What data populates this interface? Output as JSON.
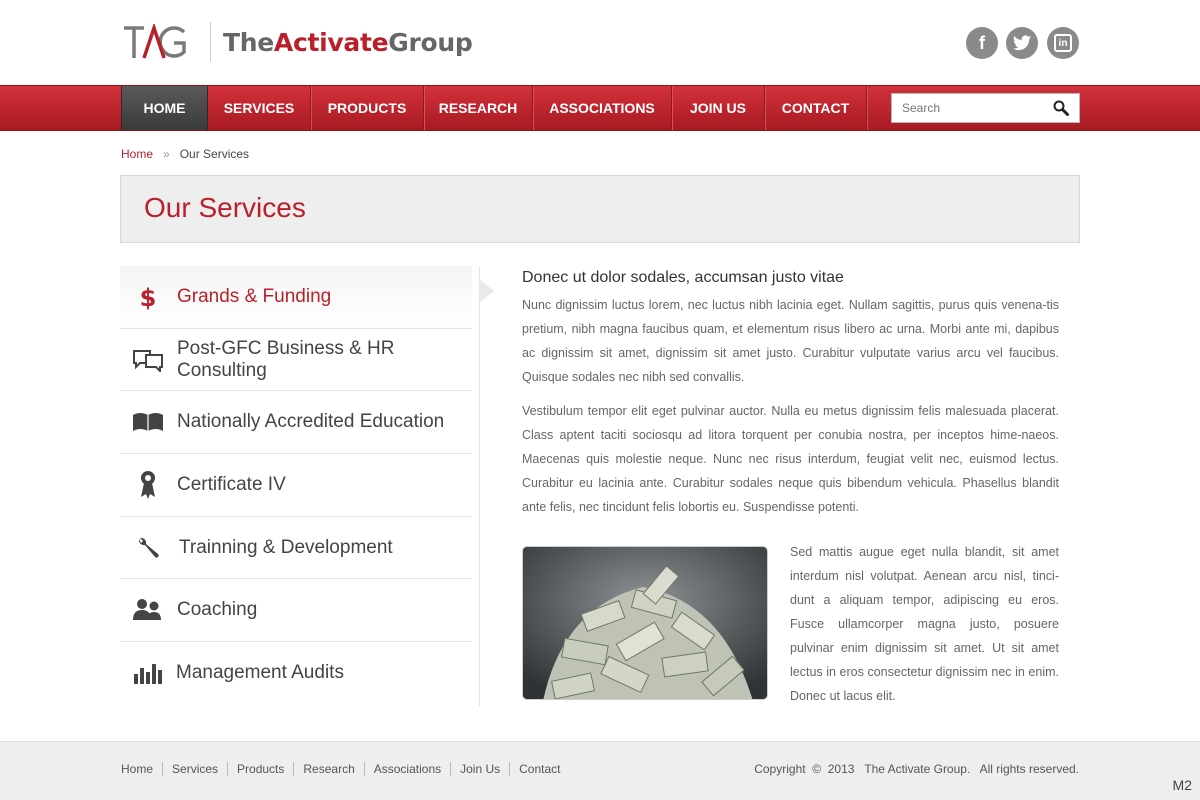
{
  "header": {
    "logo_mark": "TAG",
    "logo_part1": "The",
    "logo_part2": "Activate",
    "logo_part3": "Group",
    "social": [
      {
        "name": "facebook",
        "glyph": "f"
      },
      {
        "name": "twitter",
        "glyph": "t"
      },
      {
        "name": "linkedin",
        "glyph": "in"
      }
    ]
  },
  "nav": {
    "items": [
      "HOME",
      "SERVICES",
      "PRODUCTS",
      "RESEARCH",
      "ASSOCIATIONS",
      "JOIN US",
      "CONTACT"
    ],
    "active": "HOME",
    "search_placeholder": "Search"
  },
  "breadcrumb": {
    "home": "Home",
    "sep": "»",
    "current": "Our Services"
  },
  "page_title": "Our Services",
  "sidebar": {
    "items": [
      {
        "label": "Grands & Funding",
        "icon": "dollar-icon"
      },
      {
        "label": "Post-GFC Business & HR Consulting",
        "icon": "chat-bubbles-icon"
      },
      {
        "label": "Nationally Accredited Education",
        "icon": "open-book-icon"
      },
      {
        "label": "Certificate IV",
        "icon": "award-ribbon-icon"
      },
      {
        "label": "Trainning & Development",
        "icon": "wrench-icon"
      },
      {
        "label": "Coaching",
        "icon": "people-icon"
      },
      {
        "label": "Management Audits",
        "icon": "bar-chart-icon"
      }
    ]
  },
  "content": {
    "heading": "Donec ut dolor sodales, accumsan justo vitae",
    "paragraph1": "Nunc dignissim luctus lorem, nec luctus nibh lacinia eget. Nullam sagittis, purus quis venena-tis pretium, nibh magna faucibus quam, et elementum risus libero ac urna. Morbi ante mi, dapibus ac dignissim sit amet, dignissim sit amet justo. Curabitur vulputate varius arcu vel faucibus. Quisque sodales nec nibh sed convallis.",
    "paragraph2": "Vestibulum tempor elit eget pulvinar auctor. Nulla eu metus dignissim felis malesuada placerat. Class aptent taciti sociosqu ad litora torquent per conubia nostra, per inceptos hime-naeos. Maecenas quis molestie neque. Nunc nec risus interdum, feugiat velit nec, euismod lectus. Curabitur eu lacinia ante. Curabitur sodales neque quis bibendum vehicula. Phasellus blandit ante felis, nec tincidunt felis lobortis eu. Suspendisse potenti.",
    "paragraph3": "Sed mattis augue eget nulla blandit, sit amet interdum nisl volutpat. Aenean arcu nisl, tinci-dunt a aliquam tempor, adipiscing eu eros. Fusce ullamcorper magna justo, posuere pulvinar enim dignissim sit amet.  Ut sit amet lectus in eros consectetur dignissim nec in enim. Donec ut lacus elit."
  },
  "footer": {
    "links": [
      "Home",
      "Services",
      "Products",
      "Research",
      "Associations",
      "Join Us",
      "Contact"
    ],
    "copyright": "Copyright  ©  2013   The Activate Group.   All rights reserved.",
    "badge": "M2"
  },
  "colors": {
    "brand_red": "#b8212b",
    "nav_active": "#4a4a4a",
    "footer_bg": "#eeeeee"
  }
}
